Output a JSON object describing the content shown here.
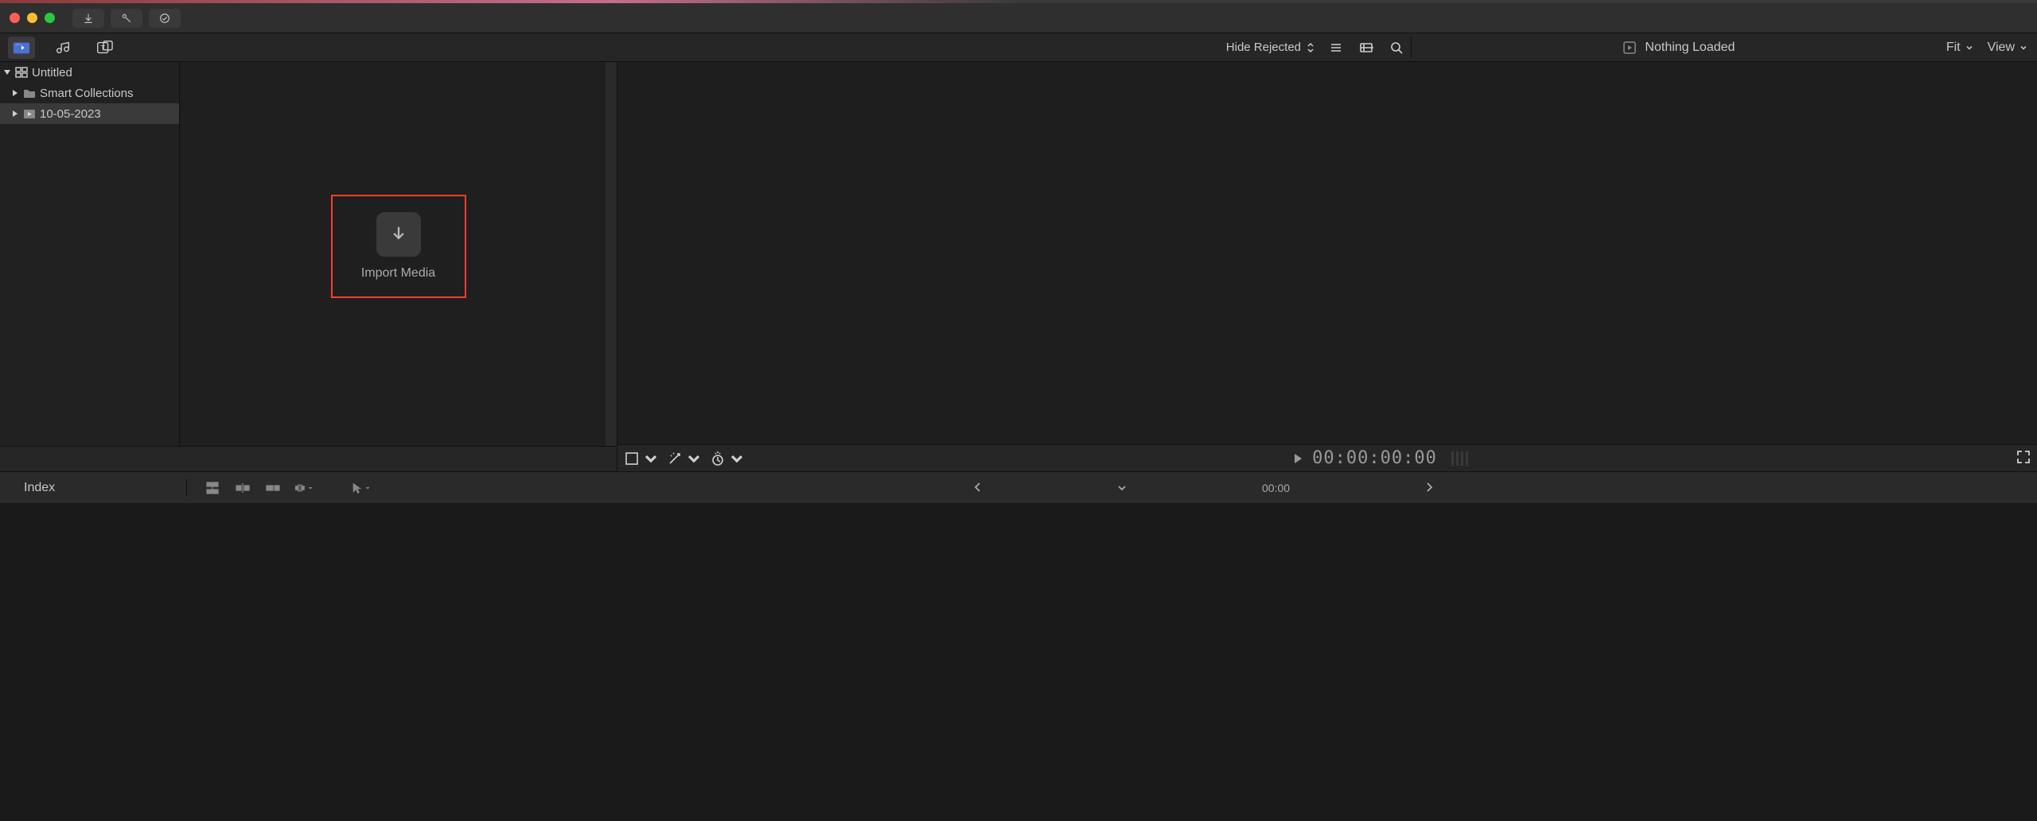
{
  "titlebar": {},
  "toolbar": {
    "hide_rejected_label": "Hide Rejected"
  },
  "viewer": {
    "title": "Nothing Loaded",
    "fit_label": "Fit",
    "view_label": "View",
    "timecode": "00:00:00:00"
  },
  "sidebar": {
    "root": "Untitled",
    "items": [
      {
        "label": "Smart Collections"
      },
      {
        "label": "10-05-2023"
      }
    ]
  },
  "browser": {
    "import_label": "Import Media"
  },
  "timeline": {
    "index_label": "Index",
    "time_label": "00:00"
  }
}
